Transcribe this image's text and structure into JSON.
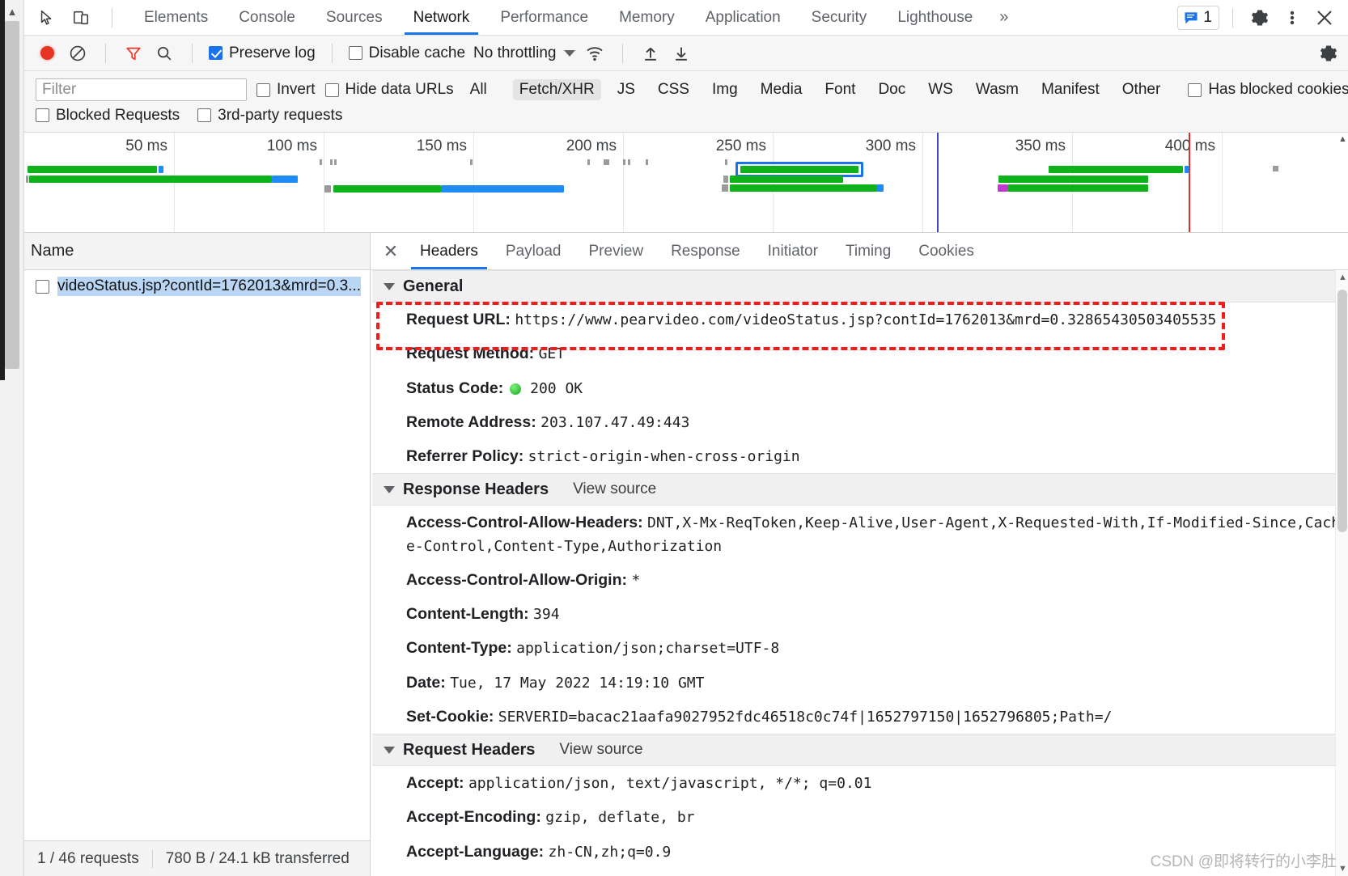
{
  "devtools": {
    "top_tabs": [
      {
        "label": "Elements",
        "active": false
      },
      {
        "label": "Console",
        "active": false
      },
      {
        "label": "Sources",
        "active": false
      },
      {
        "label": "Network",
        "active": true
      },
      {
        "label": "Performance",
        "active": false
      },
      {
        "label": "Memory",
        "active": false
      },
      {
        "label": "Application",
        "active": false
      },
      {
        "label": "Security",
        "active": false
      },
      {
        "label": "Lighthouse",
        "active": false
      }
    ],
    "more_tabs_label": "»",
    "message_count": "1",
    "icons": {
      "inspect": "inspect-element-icon",
      "device": "device-toolbar-icon",
      "settings": "gear-icon",
      "kebab": "more-options-icon",
      "close": "close-icon",
      "messages": "console-messages-icon"
    }
  },
  "network_toolbar": {
    "record_label": "record-button",
    "clear_label": "clear-button",
    "filter_toggle_label": "filter-icon",
    "search_label": "search-icon",
    "preserve_log": {
      "label": "Preserve log",
      "checked": true
    },
    "disable_cache": {
      "label": "Disable cache",
      "checked": false
    },
    "throttling": "No throttling",
    "import_label": "import-har-icon",
    "export_label": "export-har-icon",
    "settings_label": "network-settings-icon",
    "wifi_label": "throttling-profiles-icon"
  },
  "filters": {
    "input_placeholder": "Filter",
    "input_value": "",
    "invert": {
      "label": "Invert",
      "checked": false
    },
    "hide_data_urls": {
      "label": "Hide data URLs",
      "checked": false
    },
    "types": [
      {
        "label": "All",
        "active": false
      },
      {
        "label": "Fetch/XHR",
        "active": true
      },
      {
        "label": "JS",
        "active": false
      },
      {
        "label": "CSS",
        "active": false
      },
      {
        "label": "Img",
        "active": false
      },
      {
        "label": "Media",
        "active": false
      },
      {
        "label": "Font",
        "active": false
      },
      {
        "label": "Doc",
        "active": false
      },
      {
        "label": "WS",
        "active": false
      },
      {
        "label": "Wasm",
        "active": false
      },
      {
        "label": "Manifest",
        "active": false
      },
      {
        "label": "Other",
        "active": false
      }
    ],
    "has_blocked_cookies": {
      "label": "Has blocked cookies",
      "checked": false
    },
    "blocked_requests": {
      "label": "Blocked Requests",
      "checked": false
    },
    "third_party": {
      "label": "3rd-party requests",
      "checked": false
    }
  },
  "overview": {
    "ticks": [
      "50 ms",
      "100 ms",
      "150 ms",
      "200 ms",
      "250 ms",
      "300 ms",
      "350 ms",
      "400 ms"
    ],
    "colors": {
      "green": "#0fb21a",
      "blue": "#1f8bf5",
      "selection": "#1a73e8",
      "dom": "#3b48cc",
      "load": "#e82c2c",
      "grey": "#9b9b9b",
      "purple": "#c03ad1"
    }
  },
  "request_list": {
    "column_header": "Name",
    "rows": [
      {
        "name": "videoStatus.jsp?contId=1762013&mrd=0.3...",
        "selected": true
      }
    ]
  },
  "status_bar": {
    "requests": "1 / 46 requests",
    "transferred": "780 B / 24.1 kB transferred"
  },
  "detail_tabs": [
    {
      "label": "Headers",
      "active": true
    },
    {
      "label": "Payload",
      "active": false
    },
    {
      "label": "Preview",
      "active": false
    },
    {
      "label": "Response",
      "active": false
    },
    {
      "label": "Initiator",
      "active": false
    },
    {
      "label": "Timing",
      "active": false
    },
    {
      "label": "Cookies",
      "active": false
    }
  ],
  "sections": {
    "general": {
      "title": "General",
      "rows": [
        {
          "key": "Request URL:",
          "value": "https://www.pearvideo.com/videoStatus.jsp?contId=1762013&mrd=0.32865430503405535",
          "highlight": true
        },
        {
          "key": "Request Method:",
          "value": "GET"
        },
        {
          "key": "Status Code:",
          "value": "200 OK",
          "status_dot": true
        },
        {
          "key": "Remote Address:",
          "value": "203.107.47.49:443"
        },
        {
          "key": "Referrer Policy:",
          "value": "strict-origin-when-cross-origin"
        }
      ]
    },
    "response_headers": {
      "title": "Response Headers",
      "view_source": "View source",
      "rows": [
        {
          "key": "Access-Control-Allow-Headers:",
          "value": "DNT,X-Mx-ReqToken,Keep-Alive,User-Agent,X-Requested-With,If-Modified-Since,Cache-Control,Content-Type,Authorization"
        },
        {
          "key": "Access-Control-Allow-Origin:",
          "value": "*"
        },
        {
          "key": "Content-Length:",
          "value": "394"
        },
        {
          "key": "Content-Type:",
          "value": "application/json;charset=UTF-8"
        },
        {
          "key": "Date:",
          "value": "Tue, 17 May 2022 14:19:10 GMT"
        },
        {
          "key": "Set-Cookie:",
          "value": "SERVERID=bacac21aafa9027952fdc46518c0c74f|1652797150|1652796805;Path=/"
        }
      ]
    },
    "request_headers": {
      "title": "Request Headers",
      "view_source": "View source",
      "rows": [
        {
          "key": "Accept:",
          "value": "application/json, text/javascript, */*; q=0.01"
        },
        {
          "key": "Accept-Encoding:",
          "value": "gzip, deflate, br"
        },
        {
          "key": "Accept-Language:",
          "value": "zh-CN,zh;q=0.9"
        }
      ]
    }
  },
  "watermark": "CSDN @即将转行的小李肚"
}
